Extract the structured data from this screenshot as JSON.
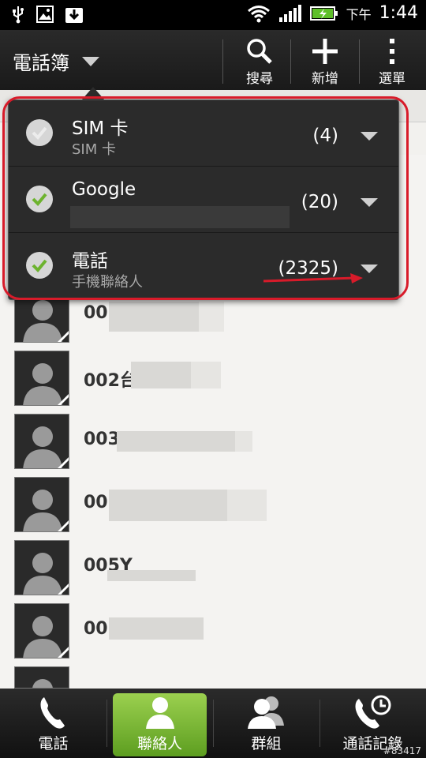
{
  "status_bar": {
    "am_pm": "下午",
    "time": "1:44"
  },
  "action_bar": {
    "title": "電話簿",
    "buttons": [
      {
        "label": "搜尋",
        "icon": "search-icon"
      },
      {
        "label": "新增",
        "icon": "plus-icon"
      },
      {
        "label": "選單",
        "icon": "overflow-menu-icon"
      }
    ]
  },
  "accounts": [
    {
      "name": "SIM 卡",
      "sub": "SIM 卡",
      "count": "(4)",
      "checked": false
    },
    {
      "name": "Google",
      "sub": "",
      "count": "(20)",
      "checked": true
    },
    {
      "name": "電話",
      "sub": "手機聯絡人",
      "count": "(2325)",
      "checked": true
    }
  ],
  "contacts": [
    {
      "name": "00"
    },
    {
      "name": "002台"
    },
    {
      "name": "003"
    },
    {
      "name": "00"
    },
    {
      "name": "005Y"
    },
    {
      "name": "00"
    },
    {
      "name": ""
    }
  ],
  "tabs": [
    {
      "label": "電話",
      "icon": "phone-icon",
      "active": false
    },
    {
      "label": "聯絡人",
      "icon": "person-icon",
      "active": true
    },
    {
      "label": "群組",
      "icon": "group-icon",
      "active": false
    },
    {
      "label": "通話記錄",
      "icon": "call-history-icon",
      "active": false
    }
  ],
  "watermark": "#83417",
  "colors": {
    "accent_green": "#7cbd35",
    "annotation_red": "#d81b2a"
  }
}
